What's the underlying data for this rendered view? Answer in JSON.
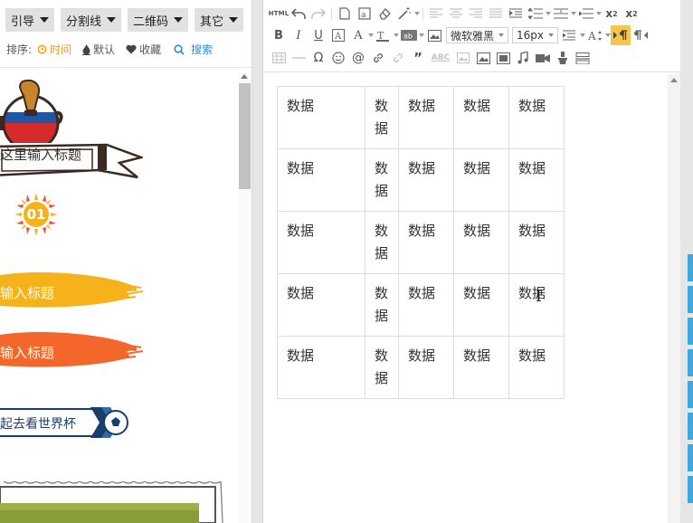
{
  "left_panel": {
    "categories": [
      {
        "label": "引导"
      },
      {
        "label": "分割线"
      },
      {
        "label": "二维码"
      },
      {
        "label": "其它"
      }
    ],
    "sort": {
      "label": "排序:",
      "options": [
        {
          "label": "时间",
          "icon": "clock-icon",
          "active": true
        },
        {
          "label": "默认",
          "icon": "flame-icon",
          "active": false
        },
        {
          "label": "收藏",
          "icon": "heart-icon",
          "active": false
        }
      ],
      "search_label": "搜索"
    },
    "templates": {
      "title_banner": "这里输入标题",
      "badge_number": "01",
      "brush_yellow": "输入标题",
      "brush_orange": "输入标题",
      "ribbon": "起去看世界杯"
    },
    "colors": {
      "yellow": "#f6b21b",
      "orange": "#f4672a",
      "navy": "#1a3f6b",
      "accent_orange": "#f29b1f",
      "accent_blue": "#2e8ad8"
    }
  },
  "editor": {
    "toolbar": {
      "font_family": "微软雅黑",
      "font_size": "16px",
      "html_label": "HTML",
      "abc_label": "ABC"
    },
    "table": {
      "rows": [
        [
          "数据",
          "数据",
          "数据",
          "数据",
          "数据"
        ],
        [
          "数据",
          "数据",
          "数据",
          "数据",
          "数据"
        ],
        [
          "数据",
          "数据",
          "数据",
          "数据",
          "数据"
        ],
        [
          "数据",
          "数据",
          "数据",
          "数据",
          "数据"
        ],
        [
          "数据",
          "数据",
          "数据",
          "数据",
          "数据"
        ]
      ]
    }
  }
}
